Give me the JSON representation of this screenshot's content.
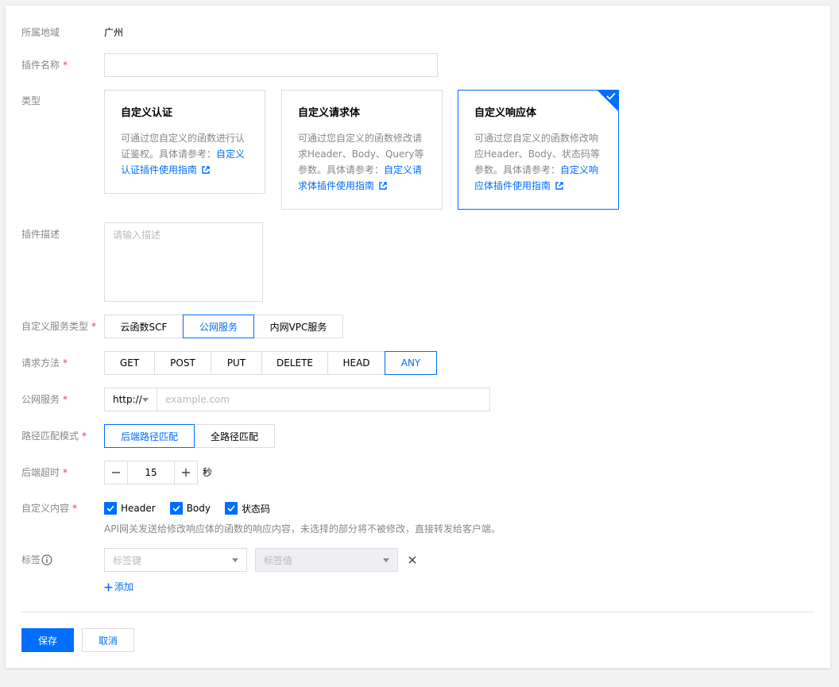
{
  "form": {
    "region": {
      "label": "所属地域",
      "value": "广州"
    },
    "plugin_name": {
      "label": "插件名称",
      "value": "",
      "placeholder": ""
    },
    "type": {
      "label": "类型",
      "cards": [
        {
          "title": "自定义认证",
          "desc": "可通过您自定义的函数进行认证鉴权。具体请参考：",
          "link": "自定义认证插件使用指南",
          "selected": false
        },
        {
          "title": "自定义请求体",
          "desc": "可通过您自定义的函数修改请求Header、Body、Query等参数。具体请参考：",
          "link": "自定义请求体插件使用指南",
          "selected": false
        },
        {
          "title": "自定义响应体",
          "desc": "可通过您自定义的函数修改响应Header、Body、状态码等参数。具体请参考：",
          "link": "自定义响应体插件使用指南",
          "selected": true
        }
      ]
    },
    "description": {
      "label": "插件描述",
      "placeholder": "请输入描述"
    },
    "service_type": {
      "label": "自定义服务类型",
      "options": [
        "云函数SCF",
        "公网服务",
        "内网VPC服务"
      ],
      "selected": "公网服务"
    },
    "method": {
      "label": "请求方法",
      "options": [
        "GET",
        "POST",
        "PUT",
        "DELETE",
        "HEAD",
        "ANY"
      ],
      "selected": "ANY"
    },
    "public_service": {
      "label": "公网服务",
      "protocol": "http://",
      "placeholder": "example.com"
    },
    "path_mode": {
      "label": "路径匹配模式",
      "options": [
        "后端路径匹配",
        "全路径匹配"
      ],
      "selected": "后端路径匹配"
    },
    "timeout": {
      "label": "后端超时",
      "value": "15",
      "unit": "秒"
    },
    "custom_content": {
      "label": "自定义内容",
      "checkboxes": [
        {
          "label": "Header",
          "checked": true
        },
        {
          "label": "Body",
          "checked": true
        },
        {
          "label": "状态码",
          "checked": true
        }
      ],
      "hint": "API网关发送给修改响应体的函数的响应内容，未选择的部分将不被修改，直接转发给客户端。"
    },
    "tags": {
      "label": "标签",
      "key_placeholder": "标签键",
      "value_placeholder": "标签值",
      "add_label": "添加"
    }
  },
  "actions": {
    "save": "保存",
    "cancel": "取消"
  },
  "colors": {
    "accent": "#006eff",
    "required": "#e54545",
    "label": "#888888",
    "border": "#dddddd"
  }
}
